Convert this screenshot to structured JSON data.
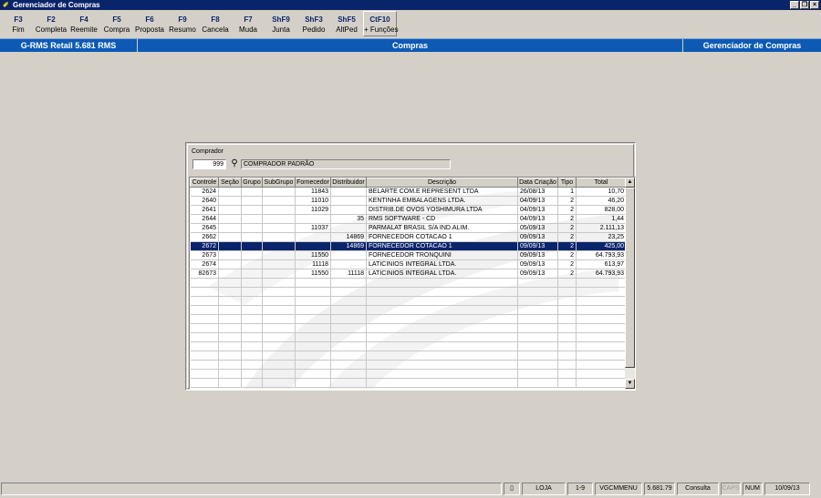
{
  "window": {
    "title": "Gerenciador de Compras"
  },
  "toolbar": [
    {
      "key": "F3",
      "label": "Fim"
    },
    {
      "key": "F2",
      "label": "Completa"
    },
    {
      "key": "F4",
      "label": "Reemite"
    },
    {
      "key": "F5",
      "label": "Compra"
    },
    {
      "key": "F6",
      "label": "Proposta"
    },
    {
      "key": "F9",
      "label": "Resumo"
    },
    {
      "key": "F8",
      "label": "Cancela"
    },
    {
      "key": "F7",
      "label": "Muda"
    },
    {
      "key": "ShF9",
      "label": "Junta"
    },
    {
      "key": "ShF3",
      "label": "Pedido"
    },
    {
      "key": "ShF5",
      "label": "AltPed"
    },
    {
      "key": "CtF10",
      "label": "+ Funções"
    }
  ],
  "header": {
    "left": "G-RMS Retail 5.681 RMS",
    "center": "Compras",
    "right": "Gerenciador de Compras"
  },
  "comprador": {
    "label": "Comprador",
    "code": "999",
    "name": "COMPRADOR PADRÃO"
  },
  "grid": {
    "columns": [
      "Controle",
      "Seção",
      "Grupo",
      "SubGrupo",
      "Fornecedor",
      "Distribuidor",
      "Descrição",
      "Data Criação",
      "Tipo",
      "Total"
    ],
    "rows": [
      [
        "2624",
        "",
        "",
        "",
        "11843",
        "",
        "BELARTE COM.E REPRESENT LTDA",
        "26/08/13",
        "1",
        "10,70"
      ],
      [
        "2640",
        "",
        "",
        "",
        "11010",
        "",
        "KENTINHA EMBALAGENS LTDA.",
        "04/09/13",
        "2",
        "46,20"
      ],
      [
        "2641",
        "",
        "",
        "",
        "11029",
        "",
        "DISTRIB.DE OVOS YOSHIMURA LTDA",
        "04/09/13",
        "2",
        "828,00"
      ],
      [
        "2644",
        "",
        "",
        "",
        "",
        "35",
        "RMS SOFTWARE - CD",
        "04/09/13",
        "2",
        "1,44"
      ],
      [
        "2645",
        "",
        "",
        "",
        "11037",
        "",
        "PARMALAT BRASIL S/A IND.ALIM.",
        "05/09/13",
        "2",
        "2.111,13"
      ],
      [
        "2662",
        "",
        "",
        "",
        "",
        "14869",
        "FORNECEDOR COTACAO 1",
        "09/09/13",
        "2",
        "23,25"
      ],
      [
        "2672",
        "",
        "",
        "",
        "",
        "14869",
        "FORNECEDOR COTACAO 1",
        "09/09/13",
        "2",
        "425,00"
      ],
      [
        "2673",
        "",
        "",
        "",
        "11550",
        "",
        "FORNECEDOR TRONQUINI",
        "09/09/13",
        "2",
        "64.793,93"
      ],
      [
        "2674",
        "",
        "",
        "",
        "11118",
        "",
        "LATICINIOS INTEGRAL LTDA.",
        "09/09/13",
        "2",
        "613,97"
      ],
      [
        "82673",
        "",
        "",
        "",
        "11550",
        "11118",
        "LATICINIOS INTEGRAL LTDA.",
        "09/09/13",
        "2",
        "64.793,93"
      ]
    ],
    "selected_index": 6,
    "empty_rows": 12
  },
  "statusbar": {
    "loja": "LOJA",
    "range": "1-9",
    "menu": "VGCMMENU",
    "version": "5.681.79",
    "mode": "Consulta",
    "caps": "CAPS",
    "num": "NUM",
    "date": "10/09/13"
  },
  "colors": {
    "titlebar": "#0a246a",
    "headerbar": "#0d5ab4",
    "selection": "#0a246a",
    "background": "#d4d0c8"
  }
}
